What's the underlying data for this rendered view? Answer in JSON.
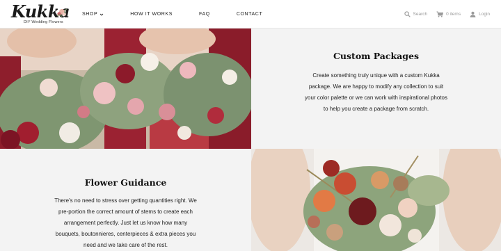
{
  "brand": {
    "name": "Kukka",
    "tagline": "DIY Wedding Flowers"
  },
  "nav": {
    "items": [
      {
        "label": "SHOP",
        "has_dropdown": true
      },
      {
        "label": "HOW IT WORKS",
        "has_dropdown": false
      },
      {
        "label": "FAQ",
        "has_dropdown": false
      },
      {
        "label": "CONTACT",
        "has_dropdown": false
      }
    ]
  },
  "utilities": {
    "search_label": "Search",
    "cart_label": "0 items",
    "login_label": "Login",
    "icons": [
      "search-icon",
      "cart-icon",
      "user-icon"
    ]
  },
  "sections": {
    "custom_packages": {
      "title": "Custom Packages",
      "lines": [
        "Create something truly unique with a custom Kukka",
        "package. We are happy to modify any collection to suit",
        "your color palette or we can work with inspirational photos",
        "to help you create a package from scratch."
      ]
    },
    "flower_guidance": {
      "title": "Flower Guidance",
      "lines": [
        "There's no need to stress over getting quantities right. We",
        "pre-portion the correct amount of stems to create each",
        "arrangement perfectly. Just let us know how many",
        "bouquets, boutonnieres, centerpieces & extra pieces you",
        "need and we take care of the rest."
      ]
    }
  },
  "colors": {
    "panel_background": "#f3f3f3",
    "icon_gray": "#9a9a9a",
    "text_dark": "#111111"
  }
}
